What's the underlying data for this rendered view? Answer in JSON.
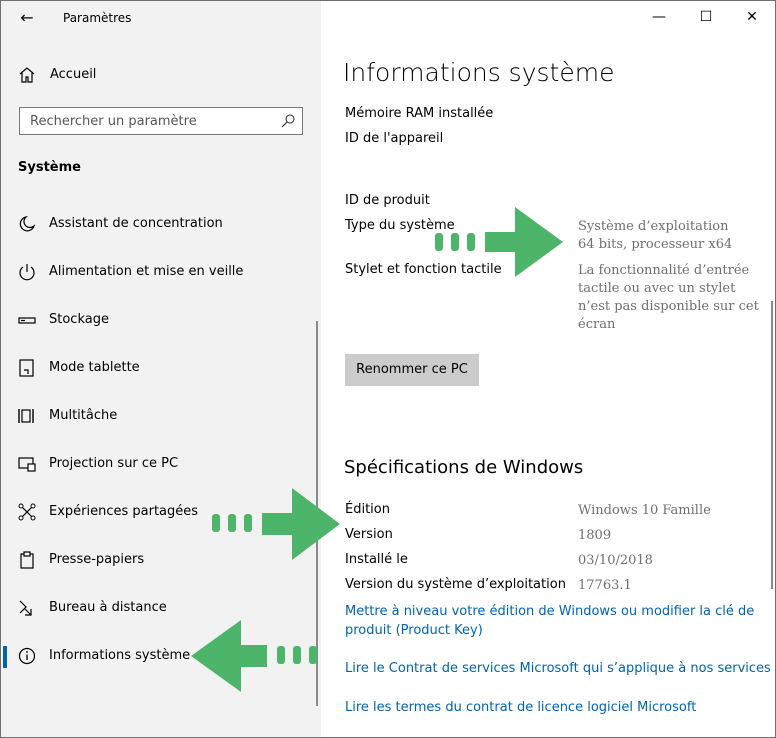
{
  "window": {
    "title": "Paramètres",
    "minimize_glyph": "—",
    "maximize_glyph": "☐",
    "close_glyph": "✕"
  },
  "sidebar": {
    "back_glyph": "←",
    "home_label": "Accueil",
    "search_placeholder": "Rechercher un paramètre",
    "section_title": "Système",
    "items": [
      {
        "label": "Assistant de concentration",
        "icon": "moon-icon"
      },
      {
        "label": "Alimentation et mise en veille",
        "icon": "power-icon"
      },
      {
        "label": "Stockage",
        "icon": "storage-icon"
      },
      {
        "label": "Mode tablette",
        "icon": "tablet-mode-icon"
      },
      {
        "label": "Multitâche",
        "icon": "multitask-icon"
      },
      {
        "label": "Projection sur ce PC",
        "icon": "projection-icon"
      },
      {
        "label": "Expériences partagées",
        "icon": "shared-experiences-icon"
      },
      {
        "label": "Presse-papiers",
        "icon": "clipboard-icon"
      },
      {
        "label": "Bureau à distance",
        "icon": "remote-desktop-icon"
      },
      {
        "label": "Informations système",
        "icon": "info-icon",
        "selected": true
      }
    ]
  },
  "main": {
    "title": "Informations système",
    "device": {
      "ram_label": "Mémoire RAM installée",
      "device_id_label": "ID de l'appareil",
      "product_id_label": "ID de produit",
      "system_type_label": "Type du système",
      "system_type_value_line1": "Système d’exploitation",
      "system_type_value_line2": "64 bits, processeur x64",
      "pen_touch_label": "Stylet et fonction tactile",
      "pen_touch_value_line1": "La fonctionnalité d’entrée",
      "pen_touch_value_line2": "tactile ou avec un stylet",
      "pen_touch_value_line3": "n’est pas disponible sur cet",
      "pen_touch_value_line4": "écran"
    },
    "rename_button": "Renommer ce PC",
    "windows_specs": {
      "heading": "Spécifications de Windows",
      "edition_label": "Édition",
      "edition_value": "Windows 10 Famille",
      "version_label": "Version",
      "version_value": "1809",
      "installed_label": "Installé le",
      "installed_value": "03/10/2018",
      "os_version_label": "Version du système d’exploitation",
      "os_version_value": "17763.1"
    },
    "links": {
      "upgrade_line1": "Mettre à niveau votre édition de Windows ou modifier la clé de",
      "upgrade_line2": "produit (Product Key)",
      "services_agreement": "Lire le Contrat de services Microsoft qui s’applique à nos services",
      "license_terms": "Lire les termes du contrat de licence logiciel Microsoft"
    }
  },
  "colors": {
    "sidebar_bg": "#f2f2f2",
    "accent": "#0063b1",
    "annotation_arrow": "#4db56a",
    "value_gray": "#6f6f6f"
  }
}
